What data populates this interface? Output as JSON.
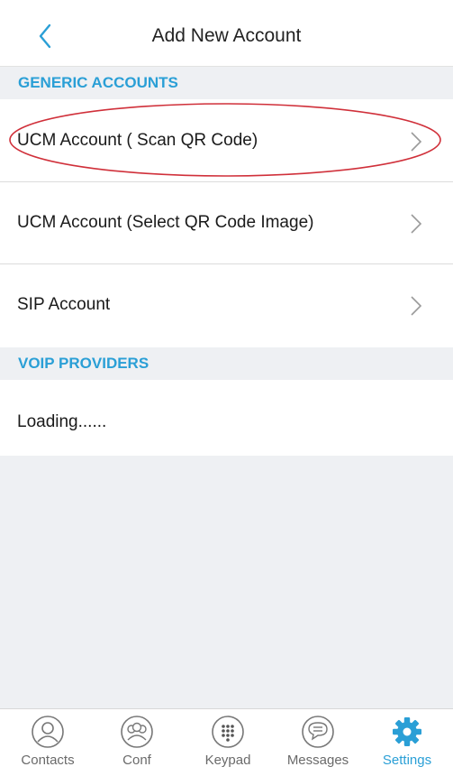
{
  "header": {
    "title": "Add New Account"
  },
  "sections": {
    "generic": {
      "title": "GENERIC ACCOUNTS",
      "items": [
        {
          "label": "UCM Account ( Scan QR Code)"
        },
        {
          "label": "UCM Account (Select QR Code Image)"
        },
        {
          "label": "SIP Account"
        }
      ]
    },
    "voip": {
      "title": "VOIP PROVIDERS",
      "status": "Loading......"
    }
  },
  "tabs": [
    {
      "label": "Contacts",
      "icon": "contacts-icon"
    },
    {
      "label": "Conf",
      "icon": "conference-icon"
    },
    {
      "label": "Keypad",
      "icon": "keypad-icon"
    },
    {
      "label": "Messages",
      "icon": "messages-icon"
    },
    {
      "label": "Settings",
      "icon": "settings-gear-icon",
      "active": true
    }
  ],
  "colors": {
    "accent": "#2a9fd6",
    "section_bg": "#eef0f3",
    "highlight": "#d0303a"
  }
}
